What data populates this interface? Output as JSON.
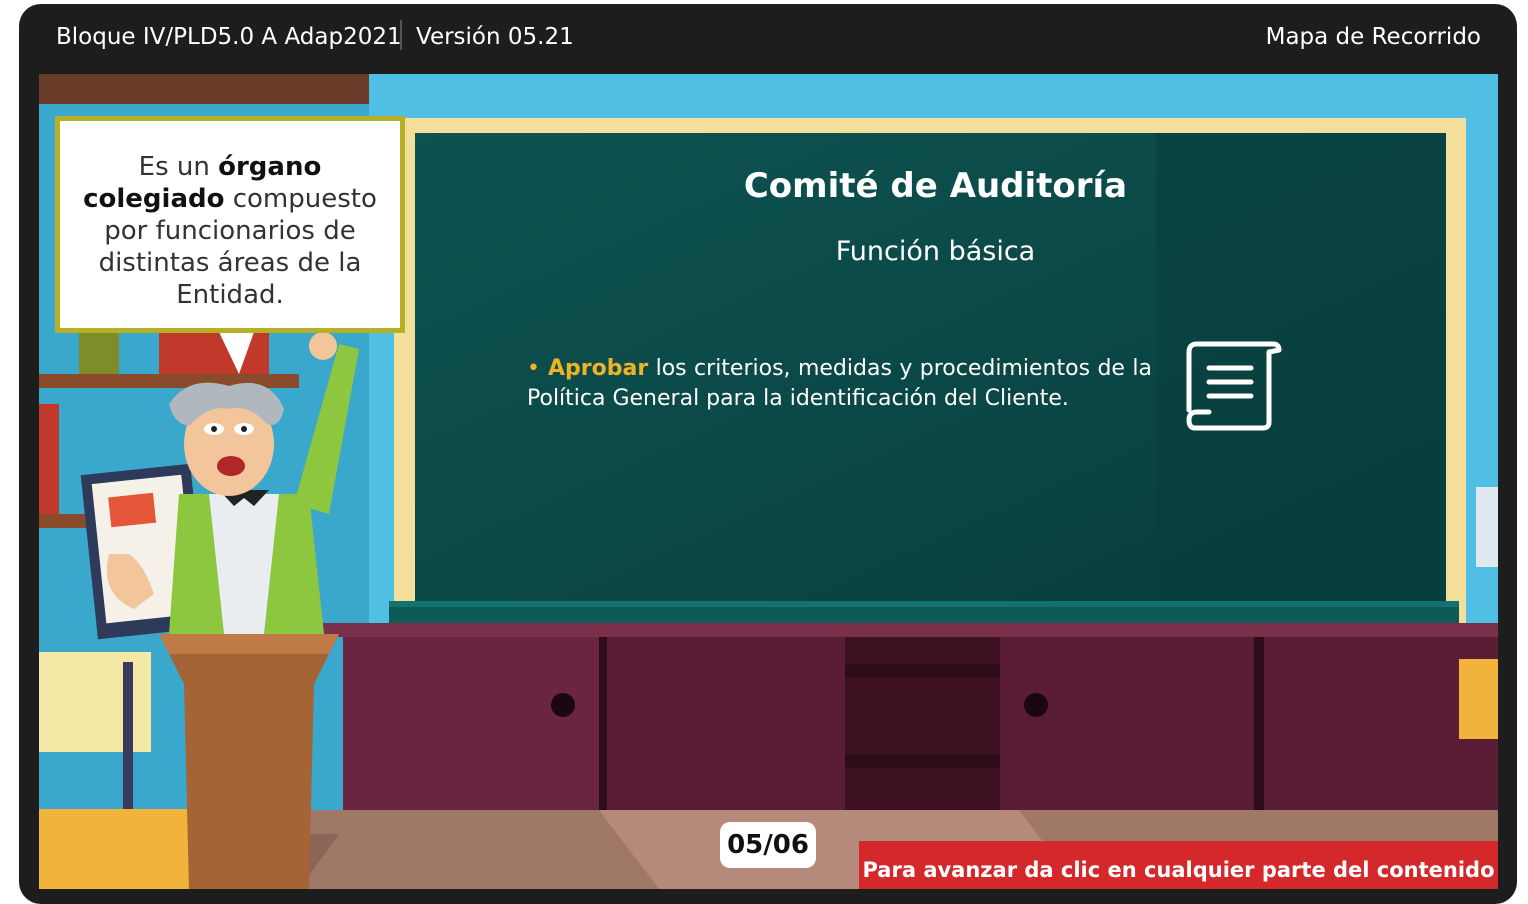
{
  "header": {
    "course_title": "Bloque IV/PLD5.0 A Adap2021",
    "version": "Versión 05.21",
    "map_link": "Mapa de Recorrido"
  },
  "bubble": {
    "text_before": "Es un ",
    "text_bold": "órgano colegiado",
    "text_after": " compuesto por funcionarios de distintas áreas de la Entidad."
  },
  "board": {
    "title": "Comité de Auditoría",
    "subtitle": "Función básica",
    "bullet": {
      "marker": "•",
      "highlight": "Aprobar",
      "text": " los criterios, medidas y procedimientos de la Política General para la identificación del Cliente."
    }
  },
  "footer": {
    "page_indicator": "05/06",
    "advance_text": "Para avanzar da clic en cualquier parte del contenido"
  },
  "colors": {
    "frame": "#1d1d1d",
    "wall": "#4fbfe3",
    "chalkboard": "#0b4d4c",
    "board_frame": "#f3df9a",
    "accent": "#f0b323",
    "cabinet": "#5a1d35",
    "advance_bg": "#d4282b",
    "bubble_border": "#b7b026"
  },
  "icons": {
    "document": "scroll-document-icon"
  }
}
